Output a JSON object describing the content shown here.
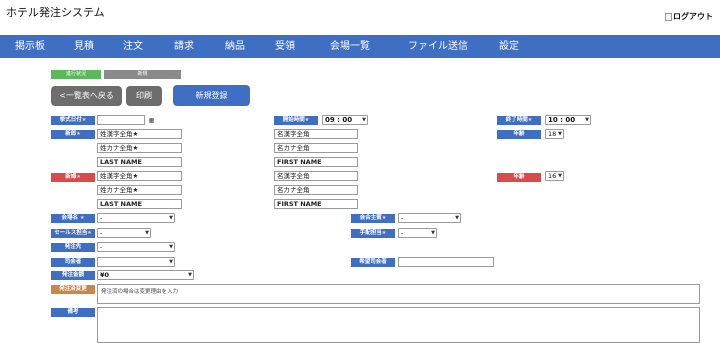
{
  "app": {
    "title": "ホテル発注システム",
    "logout_alt": "ログアウト"
  },
  "nav": {
    "items": [
      {
        "label": "掲示板"
      },
      {
        "label": "見積"
      },
      {
        "label": "注文"
      },
      {
        "label": "請求"
      },
      {
        "label": "納品"
      },
      {
        "label": "受領"
      },
      {
        "label": "会場一覧"
      },
      {
        "label": "ファイル送信"
      },
      {
        "label": "設定"
      }
    ]
  },
  "status": {
    "progress_label": "進行状況",
    "progress_value": "新規"
  },
  "actions": {
    "back": "<一覧表へ戻る",
    "print": "印刷",
    "register": "新規登録"
  },
  "form": {
    "event_date": {
      "label": "挙式日付",
      "value": ""
    },
    "start_time": {
      "label": "開始時間",
      "value": "09 : 00"
    },
    "end_time": {
      "label": "終了時間",
      "value": "10 : 00"
    },
    "groom": {
      "label": "新郎",
      "sei_kanji": "姓漢字全角★",
      "mei_kanji": "名漢字全角",
      "sei_kana": "姓カナ全角★",
      "mei_kana": "名カナ全角",
      "last_name": "LAST NAME",
      "first_name": "FIRST NAME",
      "age_label": "年齢",
      "age_value": "18"
    },
    "bride": {
      "label": "新婦",
      "sei_kanji": "姓漢字全角★",
      "mei_kanji": "名漢字全角",
      "sei_kana": "姓カナ全角★",
      "mei_kana": "名カナ全角",
      "last_name": "LAST NAME",
      "first_name": "FIRST NAME",
      "age_label": "年齢",
      "age_value": "16"
    },
    "venue": {
      "label": "会場名",
      "value": "-"
    },
    "host": {
      "label": "会合主賓",
      "value": "-"
    },
    "sales": {
      "label": "セールス担当",
      "value": "-"
    },
    "arrangement": {
      "label": "手配担当",
      "value": "-"
    },
    "vendor": {
      "label": "発注先",
      "value": "-"
    },
    "mc": {
      "label": "司会者",
      "value": ""
    },
    "desired_mc": {
      "label": "希望司会者",
      "value": ""
    },
    "amount": {
      "label": "発注金額",
      "value": "¥0"
    },
    "order_change": {
      "label": "発注済変更",
      "placeholder": "発注済の場合は変更理由を入力"
    },
    "notes": {
      "label": "備考",
      "value": ""
    }
  }
}
